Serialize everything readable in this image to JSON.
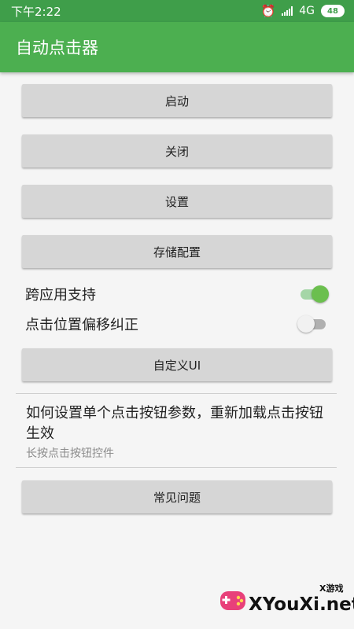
{
  "status_bar": {
    "time": "下午2:22",
    "network": "4G",
    "battery": "48",
    "icons": [
      "alarm-icon",
      "signal-icon",
      "battery-icon"
    ]
  },
  "app_bar": {
    "title": "自动点击器"
  },
  "buttons": {
    "start": "启动",
    "close": "关闭",
    "settings": "设置",
    "save_config": "存储配置",
    "custom_ui": "自定义UI",
    "faq": "常见问题"
  },
  "toggles": {
    "cross_app": {
      "label": "跨应用支持",
      "on": true
    },
    "offset_correction": {
      "label": "点击位置偏移纠正",
      "on": false
    }
  },
  "help_item": {
    "title": "如何设置单个点击按钮参数，重新加载点击按钮生效",
    "subtitle": "长按点击按钮控件"
  },
  "watermark": {
    "brand": "XYouXi.net",
    "tag": "X游戏"
  },
  "colors": {
    "status_bar": "#3f9e4a",
    "app_bar": "#4caf50",
    "button": "#d6d6d6",
    "switch_on": "#6bbf4e",
    "background": "#f5f5f5"
  }
}
